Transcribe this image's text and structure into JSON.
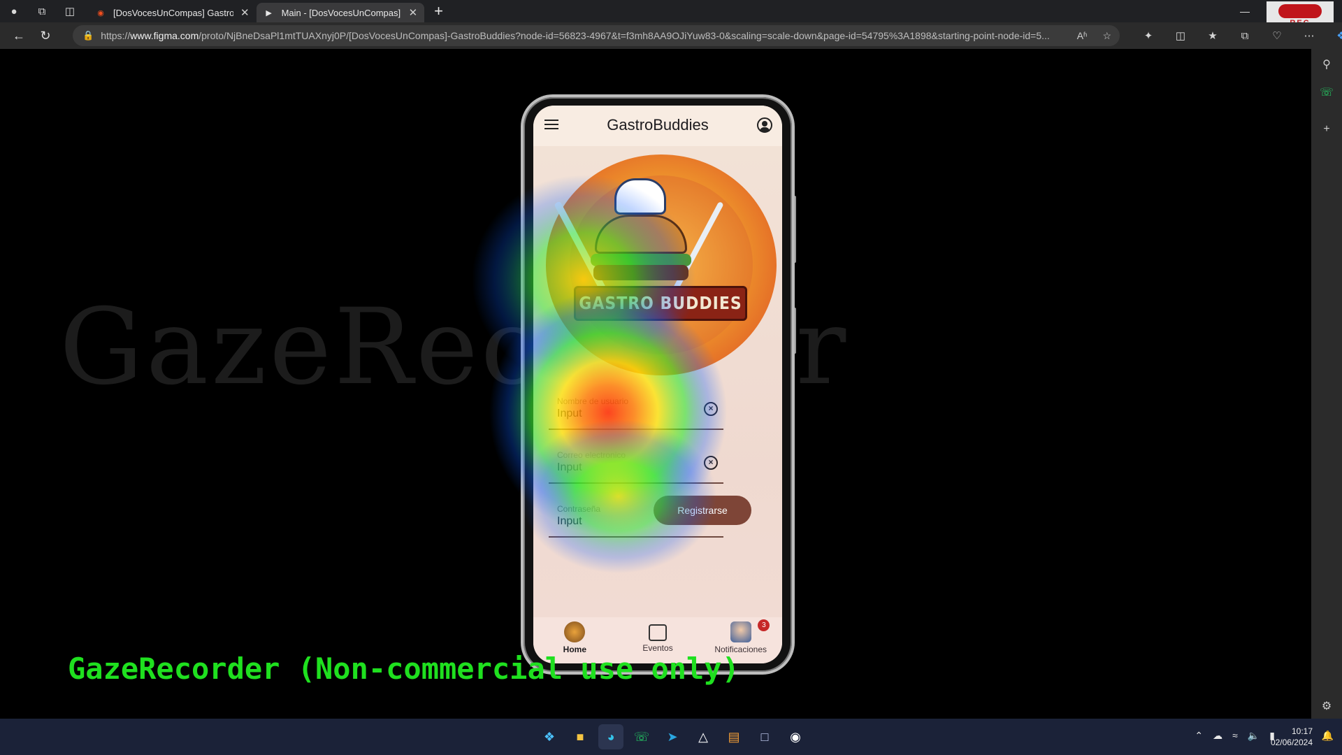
{
  "browser": {
    "tabs": [
      {
        "title": "[DosVocesUnCompas] GastroBuddies",
        "icon": "figma-icon",
        "active": false
      },
      {
        "title": "Main - [DosVocesUnCompas] GastroBuddies",
        "icon": "play-icon",
        "active": true
      }
    ],
    "new_tab": "+",
    "url_prefix": "https://",
    "url_host": "www.figma.com",
    "url_path": "/proto/NjBneDsaPl1mtTUAXnyj0P/[DosVocesUnCompas]-GastroBuddies?node-id=56823-4967&t=f3mh8AA9OJiYuw83-0&scaling=scale-down&page-id=54795%3A1898&starting-point-node-id=5...",
    "read_aloud": "Aʱ",
    "rec_label": "REC"
  },
  "viewport": {
    "watermark": "GazeRecorder",
    "gaze_label": "GazeRecorder (Non-commercial use only)"
  },
  "app": {
    "title": "GastroBuddies",
    "logo_text": "GASTRO BUDDIES",
    "fields": [
      {
        "label": "Nombre de usuario",
        "value": "Input"
      },
      {
        "label": "Correo electronico",
        "value": "Input"
      },
      {
        "label": "Contraseña",
        "value": "Input"
      }
    ],
    "clear_glyph": "×",
    "register_button": "Registrarse",
    "nav": [
      {
        "label": "Home",
        "icon": "home-burger-icon"
      },
      {
        "label": "Eventos",
        "icon": "calendar-clock-icon"
      },
      {
        "label": "Notificaciones",
        "icon": "notification-avatar-icon",
        "badge": "3"
      }
    ]
  },
  "taskbar": {
    "time": "10:17",
    "date": "02/06/2024"
  },
  "colors": {
    "accent_button": "#7e4537",
    "heat_hot": "#ff2a00",
    "heat_warm": "#ffe600",
    "heat_mid": "#2ee82e",
    "heat_cool": "#0a5cff",
    "gaze_label": "#1fe01f"
  }
}
